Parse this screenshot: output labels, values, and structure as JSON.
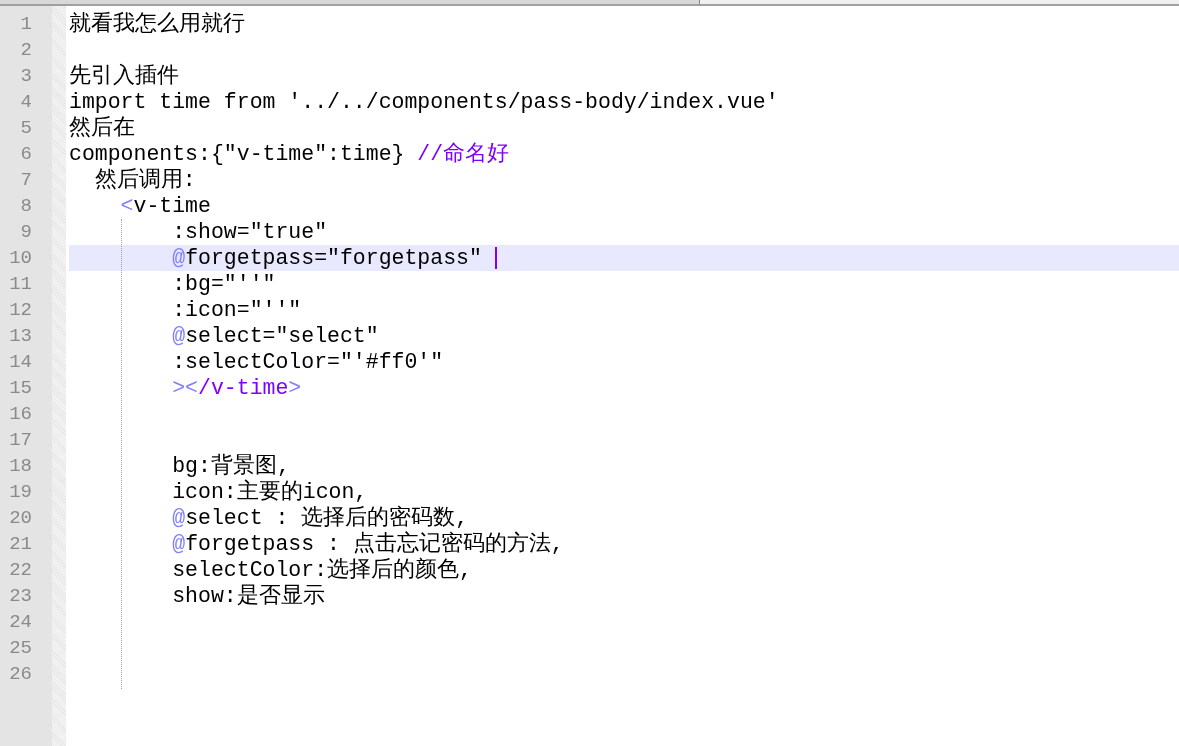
{
  "editor": {
    "lines": [
      {
        "number": "1",
        "current": false,
        "segments": [
          {
            "kind": "plain",
            "text": "就看我怎么用就行"
          }
        ]
      },
      {
        "number": "2",
        "current": false
      },
      {
        "number": "3",
        "current": false,
        "segments": [
          {
            "kind": "plain",
            "text": "先引入插件"
          }
        ]
      },
      {
        "number": "4",
        "current": false,
        "segments": [
          {
            "kind": "plain",
            "text": "import time from '../../components/pass-body/index.vue'"
          }
        ]
      },
      {
        "number": "5",
        "current": false,
        "segments": [
          {
            "kind": "plain",
            "text": "然后在"
          }
        ]
      },
      {
        "number": "6",
        "current": false,
        "segments": [
          {
            "kind": "plain",
            "text": "components:{\"v-time\":time} "
          },
          {
            "kind": "comment",
            "text": "//命名好"
          }
        ]
      },
      {
        "number": "7",
        "current": false,
        "segments": [
          {
            "kind": "plain",
            "text": "  然后调用:"
          }
        ]
      },
      {
        "number": "8",
        "current": false,
        "segments": [
          {
            "kind": "bracket",
            "text": "    <"
          },
          {
            "kind": "plain",
            "text": "v-time"
          }
        ]
      },
      {
        "number": "9",
        "current": false,
        "segments": [
          {
            "kind": "plain",
            "text": "        :show=\"true\""
          }
        ]
      },
      {
        "number": "10",
        "current": true,
        "segments": [
          {
            "kind": "at",
            "text": "        @"
          },
          {
            "kind": "plain",
            "text": "forgetpass=\"forgetpass\" "
          }
        ]
      },
      {
        "number": "11",
        "current": false,
        "segments": [
          {
            "kind": "plain",
            "text": "        :bg=\"''\""
          }
        ]
      },
      {
        "number": "12",
        "current": false,
        "segments": [
          {
            "kind": "plain",
            "text": "        :icon=\"''\""
          }
        ]
      },
      {
        "number": "13",
        "current": false,
        "segments": [
          {
            "kind": "at",
            "text": "        @"
          },
          {
            "kind": "plain",
            "text": "select=\"select\""
          }
        ]
      },
      {
        "number": "14",
        "current": false,
        "segments": [
          {
            "kind": "plain",
            "text": "        :selectColor=\"'#ff0'\""
          }
        ]
      },
      {
        "number": "15",
        "current": false,
        "segments": [
          {
            "kind": "bracket",
            "text": "        ><"
          },
          {
            "kind": "tag",
            "text": "/v-time"
          },
          {
            "kind": "bracket",
            "text": ">"
          }
        ]
      },
      {
        "number": "16",
        "current": false
      },
      {
        "number": "17",
        "current": false
      },
      {
        "number": "18",
        "current": false,
        "segments": [
          {
            "kind": "plain",
            "text": "        bg:背景图,"
          }
        ]
      },
      {
        "number": "19",
        "current": false,
        "segments": [
          {
            "kind": "plain",
            "text": "        icon:主要的icon,"
          }
        ]
      },
      {
        "number": "20",
        "current": false,
        "segments": [
          {
            "kind": "at",
            "text": "        @"
          },
          {
            "kind": "plain",
            "text": "select : 选择后的密码数,"
          }
        ]
      },
      {
        "number": "21",
        "current": false,
        "segments": [
          {
            "kind": "at",
            "text": "        @"
          },
          {
            "kind": "plain",
            "text": "forgetpass : 点击忘记密码的方法,"
          }
        ]
      },
      {
        "number": "22",
        "current": false,
        "segments": [
          {
            "kind": "plain",
            "text": "        selectColor:选择后的颜色,"
          }
        ]
      },
      {
        "number": "23",
        "current": false,
        "segments": [
          {
            "kind": "plain",
            "text": "        show:是否显示"
          }
        ]
      },
      {
        "number": "24",
        "current": false
      },
      {
        "number": "25",
        "current": false
      },
      {
        "number": "26",
        "current": false
      }
    ]
  }
}
